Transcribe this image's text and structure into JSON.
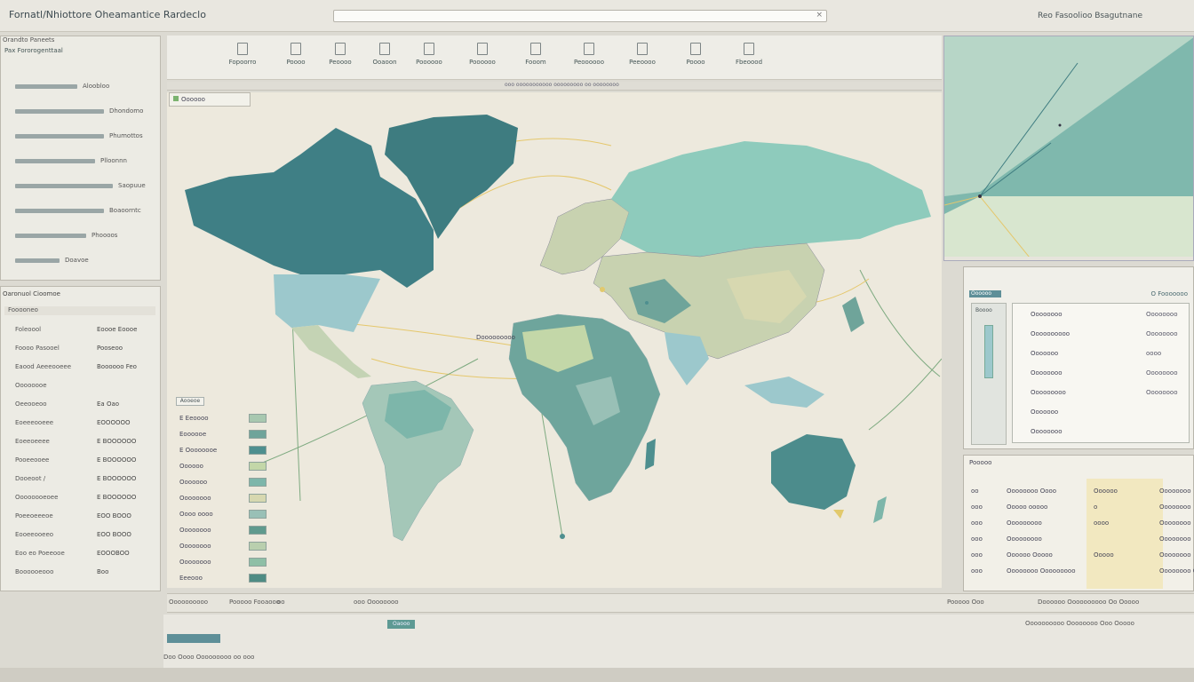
{
  "window": {
    "title": "Fornatl/Nhiottore  Oheamantice  Rardeclo",
    "account": "Reo  Fasoolioo  Bsagutnane"
  },
  "left_panel_top": {
    "header": "Orandto  Paneets",
    "subheader": "Pax  Fororogenttaal",
    "rows": [
      {
        "label": "Aloobloo",
        "bar": 70
      },
      {
        "label": "Dhondomo",
        "bar": 100
      },
      {
        "label": "Phumottos",
        "bar": 100
      },
      {
        "label": "Plloonnn",
        "bar": 90
      },
      {
        "label": "Saopuue",
        "bar": 110
      },
      {
        "label": "Boaoorntc",
        "bar": 100
      },
      {
        "label": "Phoooos",
        "bar": 80
      },
      {
        "label": "Doavoe",
        "bar": 50
      }
    ]
  },
  "left_panel_bottom": {
    "title": "Oaronuol  Cioomoe",
    "filter": "Fooooneo",
    "items": [
      {
        "key": "Foleoool",
        "val": "Eoooe  Eoooe"
      },
      {
        "key": "Foooo  Pasooel",
        "val": "Pooseoo"
      },
      {
        "key": "Eaood  Aeeeooeee",
        "val": "Boooooo  Feo"
      },
      {
        "key": "Oooooooe",
        "val": ""
      },
      {
        "key": "Oeeooeoo",
        "val": "Ea  Oao"
      },
      {
        "key": "Eoeeeooeee",
        "val": "EOOOOOO"
      },
      {
        "key": "Eoeeoeeee",
        "val": "E  BOOOOOO"
      },
      {
        "key": "Pooeeooee",
        "val": "E  BOOOOOO"
      },
      {
        "key": "Dooeoot  /",
        "val": "E  BOOOOOO"
      },
      {
        "key": "Oooooooeoee",
        "val": "E  BOOOOOO"
      },
      {
        "key": "Poeeoeeeoe",
        "val": "EOO  BOOO"
      },
      {
        "key": "Eooeeooeeo",
        "val": "EOO  BOOO"
      },
      {
        "key": "Eoo  eo  Poeeooe",
        "val": "EOOOBOO"
      },
      {
        "key": "Boooooeooo",
        "val": "Boo"
      }
    ]
  },
  "toolbar": {
    "buttons": [
      "Fopoorro",
      "Poooo",
      "Peoooo",
      "Ooaoon",
      "Poooooo",
      "Poooooo",
      "Fooom",
      "Peoooooo",
      "Peeoooo",
      "Poooo",
      "Fbeoood"
    ]
  },
  "map": {
    "strip_text": "ooo  ooooooooooo  ooooooooo  oo  oooooooo",
    "badge": "Oooooo",
    "center_label": "Dooooooooo",
    "legend": {
      "title": "Aooeoe",
      "rows": [
        "E  Eeoooo",
        "Eoooooe",
        "E  Oooooooe",
        "Oooooo",
        "Ooooooo",
        "Oooooooo",
        "Oooo  oooo",
        "Oooooooo",
        "Oooooooo",
        "Oooooooo",
        "Eeeooo"
      ],
      "swatch_colors": [
        "#a8c8b0",
        "#6fa49a",
        "#4e8f8f",
        "#c3d7a8",
        "#7db6aa",
        "#d7d8b0",
        "#99c0b6",
        "#5f9a8e",
        "#b9cfae",
        "#8ebfa6",
        "#4f8c84"
      ]
    },
    "colors": {
      "sea": "#ede9dd",
      "north_america": "#3f7f85",
      "usa": "#9cc8cc",
      "greenland": "#3e7c80",
      "russia": "#8ecbbc",
      "south_america": "#a4c7b8",
      "africa": "#6ea59c",
      "australia": "#4c8c8c",
      "asia_mixed": "#c8d2b0",
      "route": "#e5c76b",
      "route_green": "#7eaa80"
    }
  },
  "status_bar": {
    "left_label": "Oooooooooo",
    "items": [
      "Pooooo  Fooaooo",
      "oo",
      "ooo  Oooooooo",
      "Pooooo  Ooo",
      "Doooooo  Oooooooooo  Oo  Ooooo"
    ],
    "pill": "Oaooo",
    "lower_label": "Oooooooooo  Oooooooo  Ooo  Ooooo",
    "bottom_text": "Doo  Oooo  Ooooooooo  oo  ooo"
  },
  "right_info": {
    "tab": "Oooooo",
    "title": "O  Fooooooo",
    "side_label": "Boooo",
    "rows": [
      "Oooooooo",
      "Oooooooooo",
      "Ooooooo",
      "Oooooooo",
      "Ooooooooo",
      "Ooooooo",
      "Oooooooo"
    ],
    "values": [
      "Oooooooo",
      "Oooooooo",
      "oooo",
      "Oooooooo",
      "Oooooooo"
    ]
  },
  "right_table": {
    "title": "Pooooo",
    "rows": [
      {
        "c1": "oo",
        "c2": "Oooooooo  Oooo",
        "c3": "Oooooo",
        "c4": "Oooooooo"
      },
      {
        "c1": "ooo",
        "c2": "Ooooo  ooooo",
        "c3": "o",
        "c4": "Oooooooo"
      },
      {
        "c1": "ooo",
        "c2": "Ooooooooo",
        "c3": "oooo",
        "c4": "Oooooooo"
      },
      {
        "c1": "ooo",
        "c2": "Ooooooooo",
        "c3": "",
        "c4": "Oooooooo"
      },
      {
        "c1": "ooo",
        "c2": "Oooooo  Ooooo",
        "c3": "Ooooo",
        "c4": "Oooooooo"
      },
      {
        "c1": "ooo",
        "c2": "Oooooooo  Ooooooooo",
        "c3": "",
        "c4": "Oooooooo  Oooo"
      }
    ]
  }
}
